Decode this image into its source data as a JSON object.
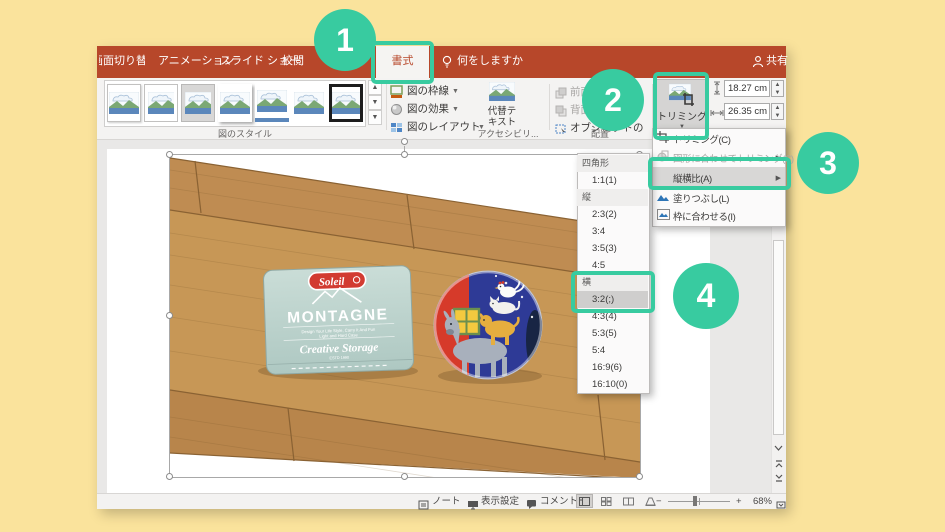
{
  "colors": {
    "accent": "#38CBA0",
    "ribbon_red": "#B7472A",
    "background_yellow": "#FAE39C"
  },
  "annotations": {
    "steps": [
      "1",
      "2",
      "3",
      "4"
    ]
  },
  "app": {
    "share_label": "共有",
    "help_label": "何をしますか",
    "tabs": [
      {
        "label": "画面切り替え"
      },
      {
        "label": "アニメーション"
      },
      {
        "label": "スライド ショー"
      },
      {
        "label": "校閲"
      },
      {
        "label": "書式"
      }
    ],
    "ribbon": {
      "styles_group_label": "図のスタイル",
      "border_label": "図の枠線",
      "effects_label": "図の効果",
      "layout_label": "図のレイアウト",
      "alt_text_label": "代替テキスト",
      "accessibility_group_label": "アクセシビリ...",
      "bring_forward_label": "前面へ移動",
      "send_backward_label": "背面へ移動",
      "selection_label": "オブジェクトの選...",
      "arrange_group_label": "配置",
      "crop_label": "トリミング",
      "height_value": "18.27 cm",
      "width_value": "26.35 cm"
    },
    "crop_menu": {
      "items": [
        {
          "label": "トリミング(C)"
        },
        {
          "label": "図形に合わせてトリミング(S)"
        },
        {
          "label": "縦横比(A)"
        },
        {
          "label": "塗りつぶし(L)"
        },
        {
          "label": "枠に合わせる(I)"
        }
      ]
    },
    "aspect_menu": {
      "square_header": "四角形",
      "square_items": [
        "1:1(1)"
      ],
      "portrait_header": "縦",
      "portrait_items": [
        "2:3(2)",
        "3:4",
        "3:5(3)",
        "4:5"
      ],
      "landscape_header": "横",
      "landscape_items": [
        "3:2(;)",
        "4:3(4)",
        "5:3(5)",
        "5:4",
        "16:9(6)",
        "16:10(0)"
      ]
    },
    "statusbar": {
      "notes_label": "ノート",
      "display_settings_label": "表示設定",
      "comments_label": "コメント",
      "zoom_value": "68%",
      "zoom_minus": "−",
      "zoom_plus": "+"
    }
  },
  "slide": {
    "tin": {
      "brand": "Soleil",
      "title": "MONTAGNE",
      "tagline1": "Design Your Life Style, Carry It And Fun",
      "tagline2": "Light and Hard Case",
      "subtitle": "Creative Storage",
      "estd": "ESTD 1990"
    }
  }
}
